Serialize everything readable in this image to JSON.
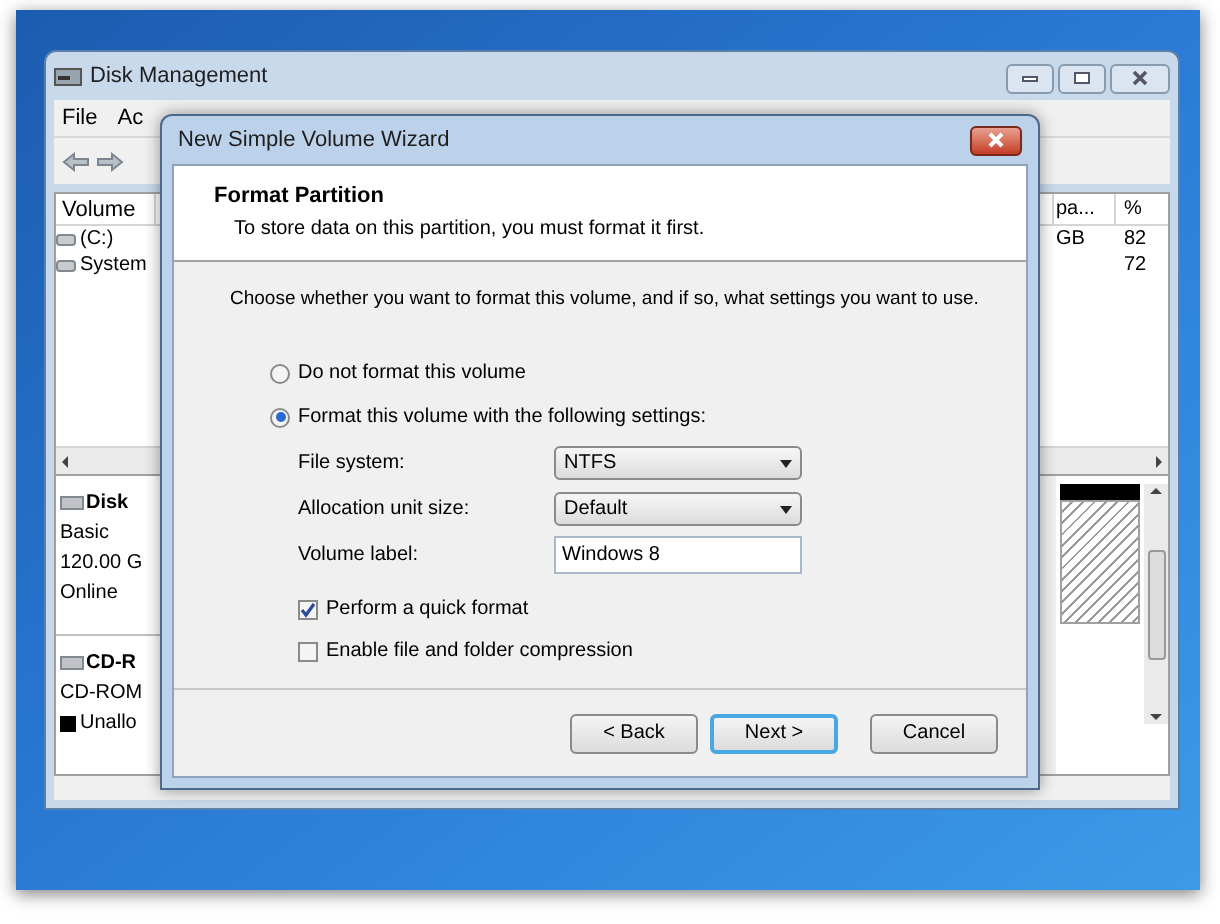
{
  "disk_management": {
    "title": "Disk Management",
    "menu": [
      "File",
      "Ac"
    ],
    "columns": [
      "Volume",
      "pa...",
      "%"
    ],
    "rows": [
      {
        "cells": [
          "(C:)",
          "GB",
          "82"
        ]
      },
      {
        "cells": [
          "System",
          "",
          "72"
        ]
      }
    ],
    "disks": [
      {
        "name": "Disk",
        "lines": [
          "Basic",
          "120.00 G",
          "Online"
        ]
      },
      {
        "name": "CD-R",
        "lines": [
          "CD-ROM"
        ]
      }
    ],
    "legend": [
      "Unallo"
    ]
  },
  "wizard": {
    "title": "New Simple Volume Wizard",
    "heading": "Format Partition",
    "subheading": "To store data on this partition, you must format it first.",
    "prompt": "Choose whether you want to format this volume, and if so, what settings you want to use.",
    "options": [
      {
        "label": "Do not format this volume",
        "selected": false
      },
      {
        "label": "Format this volume with the following settings:",
        "selected": true
      }
    ],
    "fields": [
      {
        "kind": "select",
        "label": "File system:",
        "value": "NTFS"
      },
      {
        "kind": "select",
        "label": "Allocation unit size:",
        "value": "Default"
      },
      {
        "kind": "text",
        "label": "Volume label:",
        "value": "Windows 8"
      }
    ],
    "checkboxes": [
      {
        "label": "Perform a quick format",
        "checked": true
      },
      {
        "label": "Enable file and folder compression",
        "checked": false
      }
    ],
    "buttons": [
      {
        "label": "< Back",
        "default": false
      },
      {
        "label": "Next >",
        "default": true
      },
      {
        "label": "Cancel",
        "default": false
      }
    ]
  }
}
